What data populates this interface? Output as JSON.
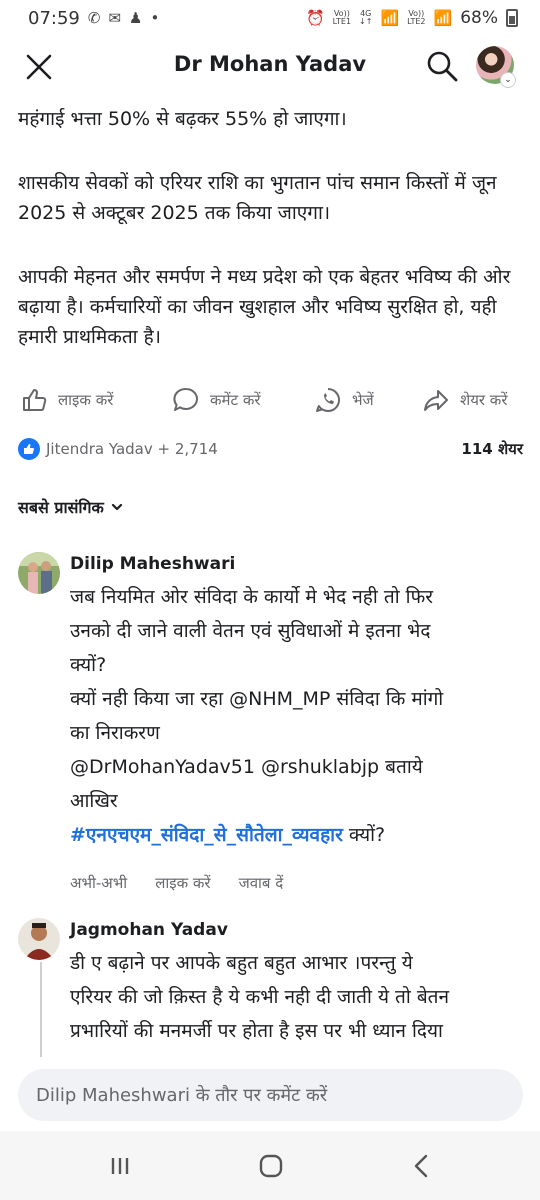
{
  "status_bar": {
    "time": "07:59",
    "net1_top": "Vo))",
    "net1_bottom": "LTE1",
    "net2_top": "4G",
    "net3_top": "Vo))",
    "net3_bottom": "LTE2",
    "battery": "68%"
  },
  "header": {
    "title": "Dr Mohan Yadav"
  },
  "post": {
    "paragraphs": [
      "महंगाई भत्ता 50% से बढ़कर 55% हो जाएगा।",
      "शासकीय सेवकों को एरियर राशि का भुगतान पांच समान किस्तों में जून 2025 से अक्टूबर 2025 तक किया जाएगा।",
      "आपकी मेहनत और समर्पण ने मध्य प्रदेश को एक बेहतर भविष्य की ओर बढ़ाया है। कर्मचारियों का जीवन खुशहाल और भविष्य सुरक्षित हो, यही हमारी प्राथमिकता है।"
    ]
  },
  "actions": {
    "like": "लाइक करें",
    "comment": "कमेंट करें",
    "send": "भेजें",
    "share": "शेयर करें"
  },
  "reactions": {
    "summary": "Jitendra Yadav + 2,714",
    "shares": "114 शेयर"
  },
  "sort": {
    "label": "सबसे प्रासंगिक"
  },
  "comments": [
    {
      "author": "Dilip Maheshwari",
      "line1": "जब नियमित ओर संविदा के कार्यो मे भेद नही तो फिर",
      "line2": "उनको दी जाने वाली वेतन एवं सुविधाओं मे इतना भेद",
      "line3": "क्यों?",
      "line4": "क्यों नही किया जा रहा @NHM_MP संविदा कि मांगो",
      "line5": "का निराकरण",
      "line6": "@DrMohanYadav51 @rshuklabjp बताये",
      "line7": "आखिर",
      "hashtag": "#एनएचएम_संविदा_से_सौतेला_व्यवहार",
      "hashtag_suffix": " क्यों?",
      "time": "अभी-अभी",
      "like": "लाइक करें",
      "reply": "जवाब दें"
    },
    {
      "author": "Jagmohan Yadav",
      "line1": "डी ए बढ़ाने पर आपके बहुत बहुत आभार ।परन्तु ये",
      "line2": "एरियर की जो क़िस्त है ये कभी नही दी जाती ये तो बेतन",
      "line3": "प्रभारियों की मनमर्जी पर होता है इस पर भी ध्यान दिया"
    }
  ],
  "composer": {
    "placeholder": "Dilip Maheshwari के तौर पर कमेंट करें"
  },
  "colors": {
    "accent": "#1877f2",
    "hashtag": "#216fdb",
    "muted": "#65676b"
  }
}
